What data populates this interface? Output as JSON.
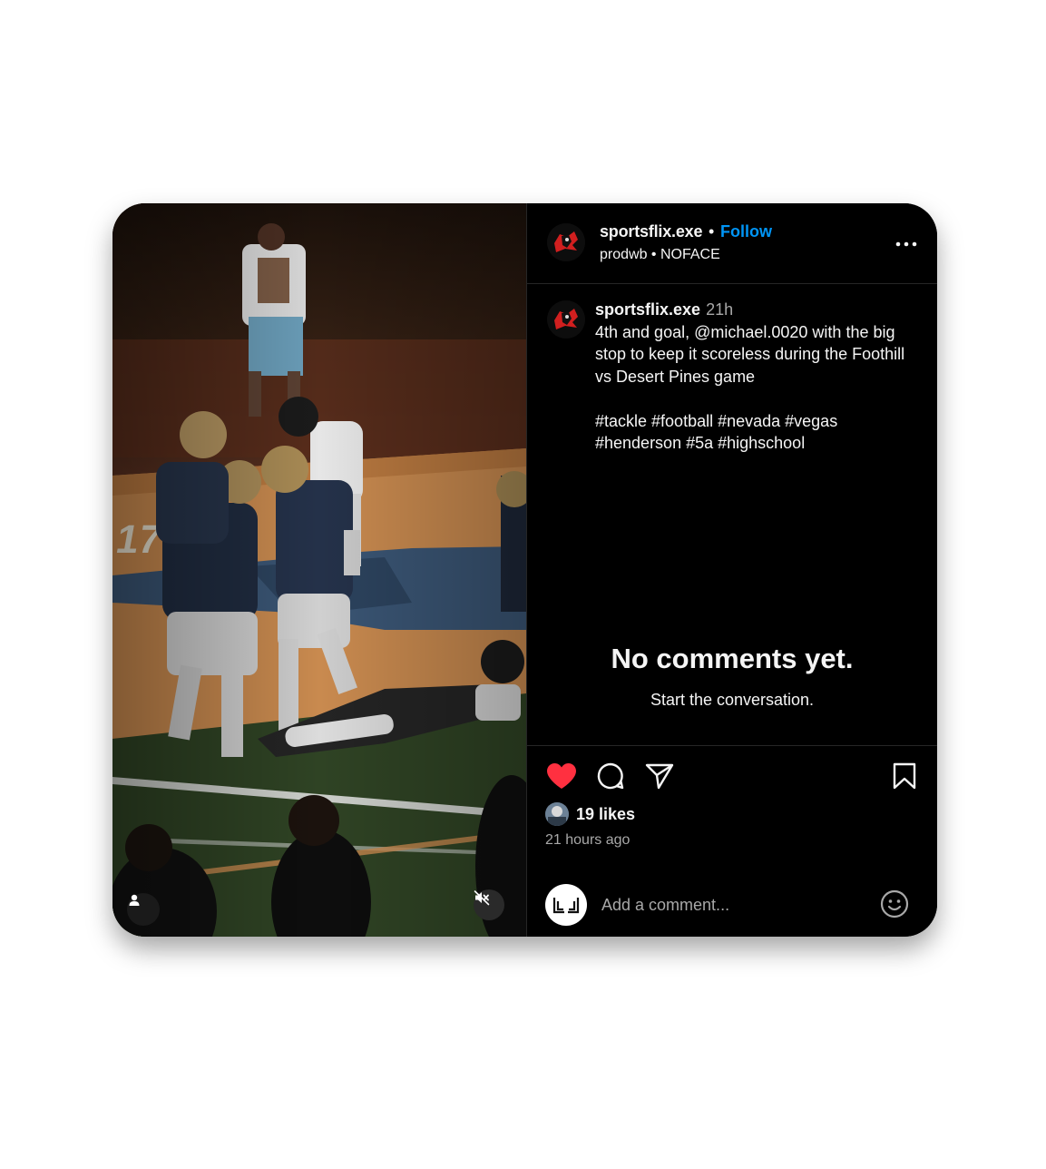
{
  "header": {
    "username": "sportsflix.exe",
    "separator": "•",
    "follow_label": "Follow",
    "subtitle": "prodwb • NOFACE",
    "more_icon": "more-horizontal-icon"
  },
  "caption": {
    "username": "sportsflix.exe",
    "time": "21h",
    "text": "4th and goal, @michael.0020 with the big stop to keep it scoreless during the Foothill vs Desert Pines game\n\n#tackle #football #nevada #vegas #henderson #5a #highschool"
  },
  "comments": {
    "empty_title": "No comments yet.",
    "empty_subtitle": "Start the conversation."
  },
  "actions": {
    "like_icon": "heart-filled-icon",
    "comment_icon": "comment-icon",
    "share_icon": "send-icon",
    "save_icon": "bookmark-icon",
    "like_color": "#ff3040"
  },
  "likes": {
    "count_label": "19 likes"
  },
  "timestamp": "21 hours ago",
  "comment_box": {
    "placeholder": "Add a comment...",
    "emoji_icon": "emoji-icon"
  },
  "media": {
    "tag_icon": "user-tag-icon",
    "mute_icon": "muted-speaker-icon"
  },
  "colors": {
    "background": "#000000",
    "accent": "#0095f6",
    "muted_text": "#a8a8a8"
  }
}
